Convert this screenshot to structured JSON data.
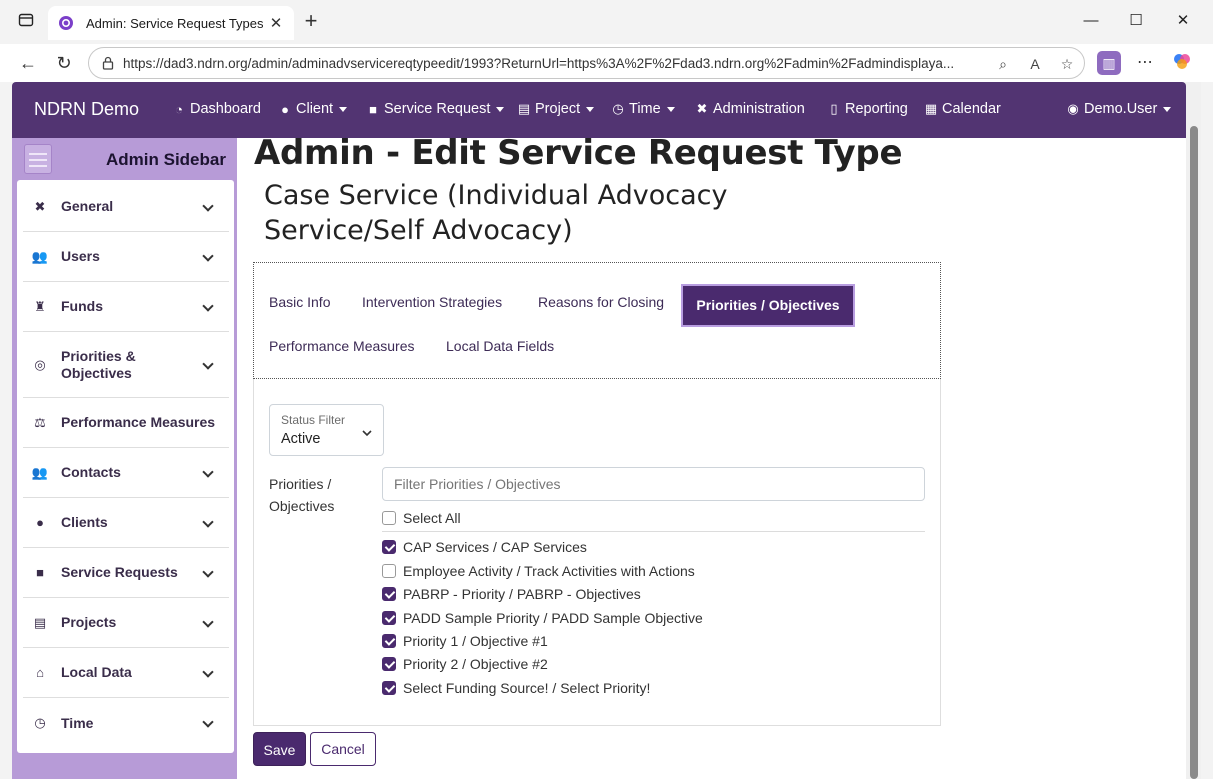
{
  "browser": {
    "tab_title": "Admin: Service Request Types",
    "url": "https://dad3.ndrn.org/admin/adminadvservicereqtypeedit/1993?ReturnUrl=https%3A%2F%2Fdad3.ndrn.org%2Fadmin%2Fadmindisplaya..."
  },
  "navbar": {
    "brand": "NDRN Demo",
    "items": [
      {
        "label": "Dashboard",
        "icon": "dashboard-icon",
        "dropdown": false
      },
      {
        "label": "Client",
        "icon": "user-icon",
        "dropdown": true
      },
      {
        "label": "Service Request",
        "icon": "briefcase-icon",
        "dropdown": true
      },
      {
        "label": "Project",
        "icon": "clipboard-icon",
        "dropdown": true
      },
      {
        "label": "Time",
        "icon": "clock-icon",
        "dropdown": true
      },
      {
        "label": "Administration",
        "icon": "tools-icon",
        "dropdown": false
      },
      {
        "label": "Reporting",
        "icon": "file-icon",
        "dropdown": false
      },
      {
        "label": "Calendar",
        "icon": "calendar-icon",
        "dropdown": false
      }
    ],
    "user": "Demo.User"
  },
  "sidebar": {
    "title": "Admin Sidebar",
    "items": [
      {
        "label": "General",
        "icon": "tools-icon",
        "expandable": true
      },
      {
        "label": "Users",
        "icon": "users-icon",
        "expandable": true
      },
      {
        "label": "Funds",
        "icon": "money-bag-icon",
        "expandable": true
      },
      {
        "label": "Priorities & Objectives",
        "icon": "target-icon",
        "expandable": true
      },
      {
        "label": "Performance Measures",
        "icon": "scale-icon",
        "expandable": false
      },
      {
        "label": "Contacts",
        "icon": "contacts-icon",
        "expandable": true
      },
      {
        "label": "Clients",
        "icon": "user-icon",
        "expandable": true
      },
      {
        "label": "Service Requests",
        "icon": "briefcase-icon",
        "expandable": true
      },
      {
        "label": "Projects",
        "icon": "clipboard-icon",
        "expandable": true
      },
      {
        "label": "Local Data",
        "icon": "house-icon",
        "expandable": true
      },
      {
        "label": "Time",
        "icon": "clock-icon",
        "expandable": true
      }
    ]
  },
  "page": {
    "title": "Admin - Edit Service Request Type",
    "subtitle": "Case Service (Individual Advocacy Service/Self Advocacy)"
  },
  "tabs": [
    {
      "label": "Basic Info",
      "active": false
    },
    {
      "label": "Intervention Strategies",
      "active": false
    },
    {
      "label": "Reasons for Closing",
      "active": false
    },
    {
      "label": "Priorities / Objectives",
      "active": true
    },
    {
      "label": "Performance Measures",
      "active": false
    },
    {
      "label": "Local Data Fields",
      "active": false
    }
  ],
  "status_filter": {
    "label": "Status Filter",
    "value": "Active"
  },
  "priorities": {
    "label": "Priorities / Objectives",
    "filter_placeholder": "Filter Priorities / Objectives",
    "select_all": {
      "label": "Select All",
      "checked": false
    },
    "options": [
      {
        "label": "CAP Services / CAP Services",
        "checked": true
      },
      {
        "label": "Employee Activity / Track Activities with Actions",
        "checked": false
      },
      {
        "label": "PABRP - Priority / PABRP - Objectives",
        "checked": true
      },
      {
        "label": "PADD Sample Priority / PADD Sample Objective",
        "checked": true
      },
      {
        "label": "Priority 1 / Objective #1",
        "checked": true
      },
      {
        "label": "Priority 2 / Objective #2",
        "checked": true
      },
      {
        "label": "Select Funding Source! / Select Priority!",
        "checked": true
      }
    ]
  },
  "actions": {
    "save": "Save",
    "cancel": "Cancel"
  },
  "colors": {
    "primary": "#523472",
    "sidebar": "#b79bd7",
    "active_tab": "#4a2a6e"
  }
}
